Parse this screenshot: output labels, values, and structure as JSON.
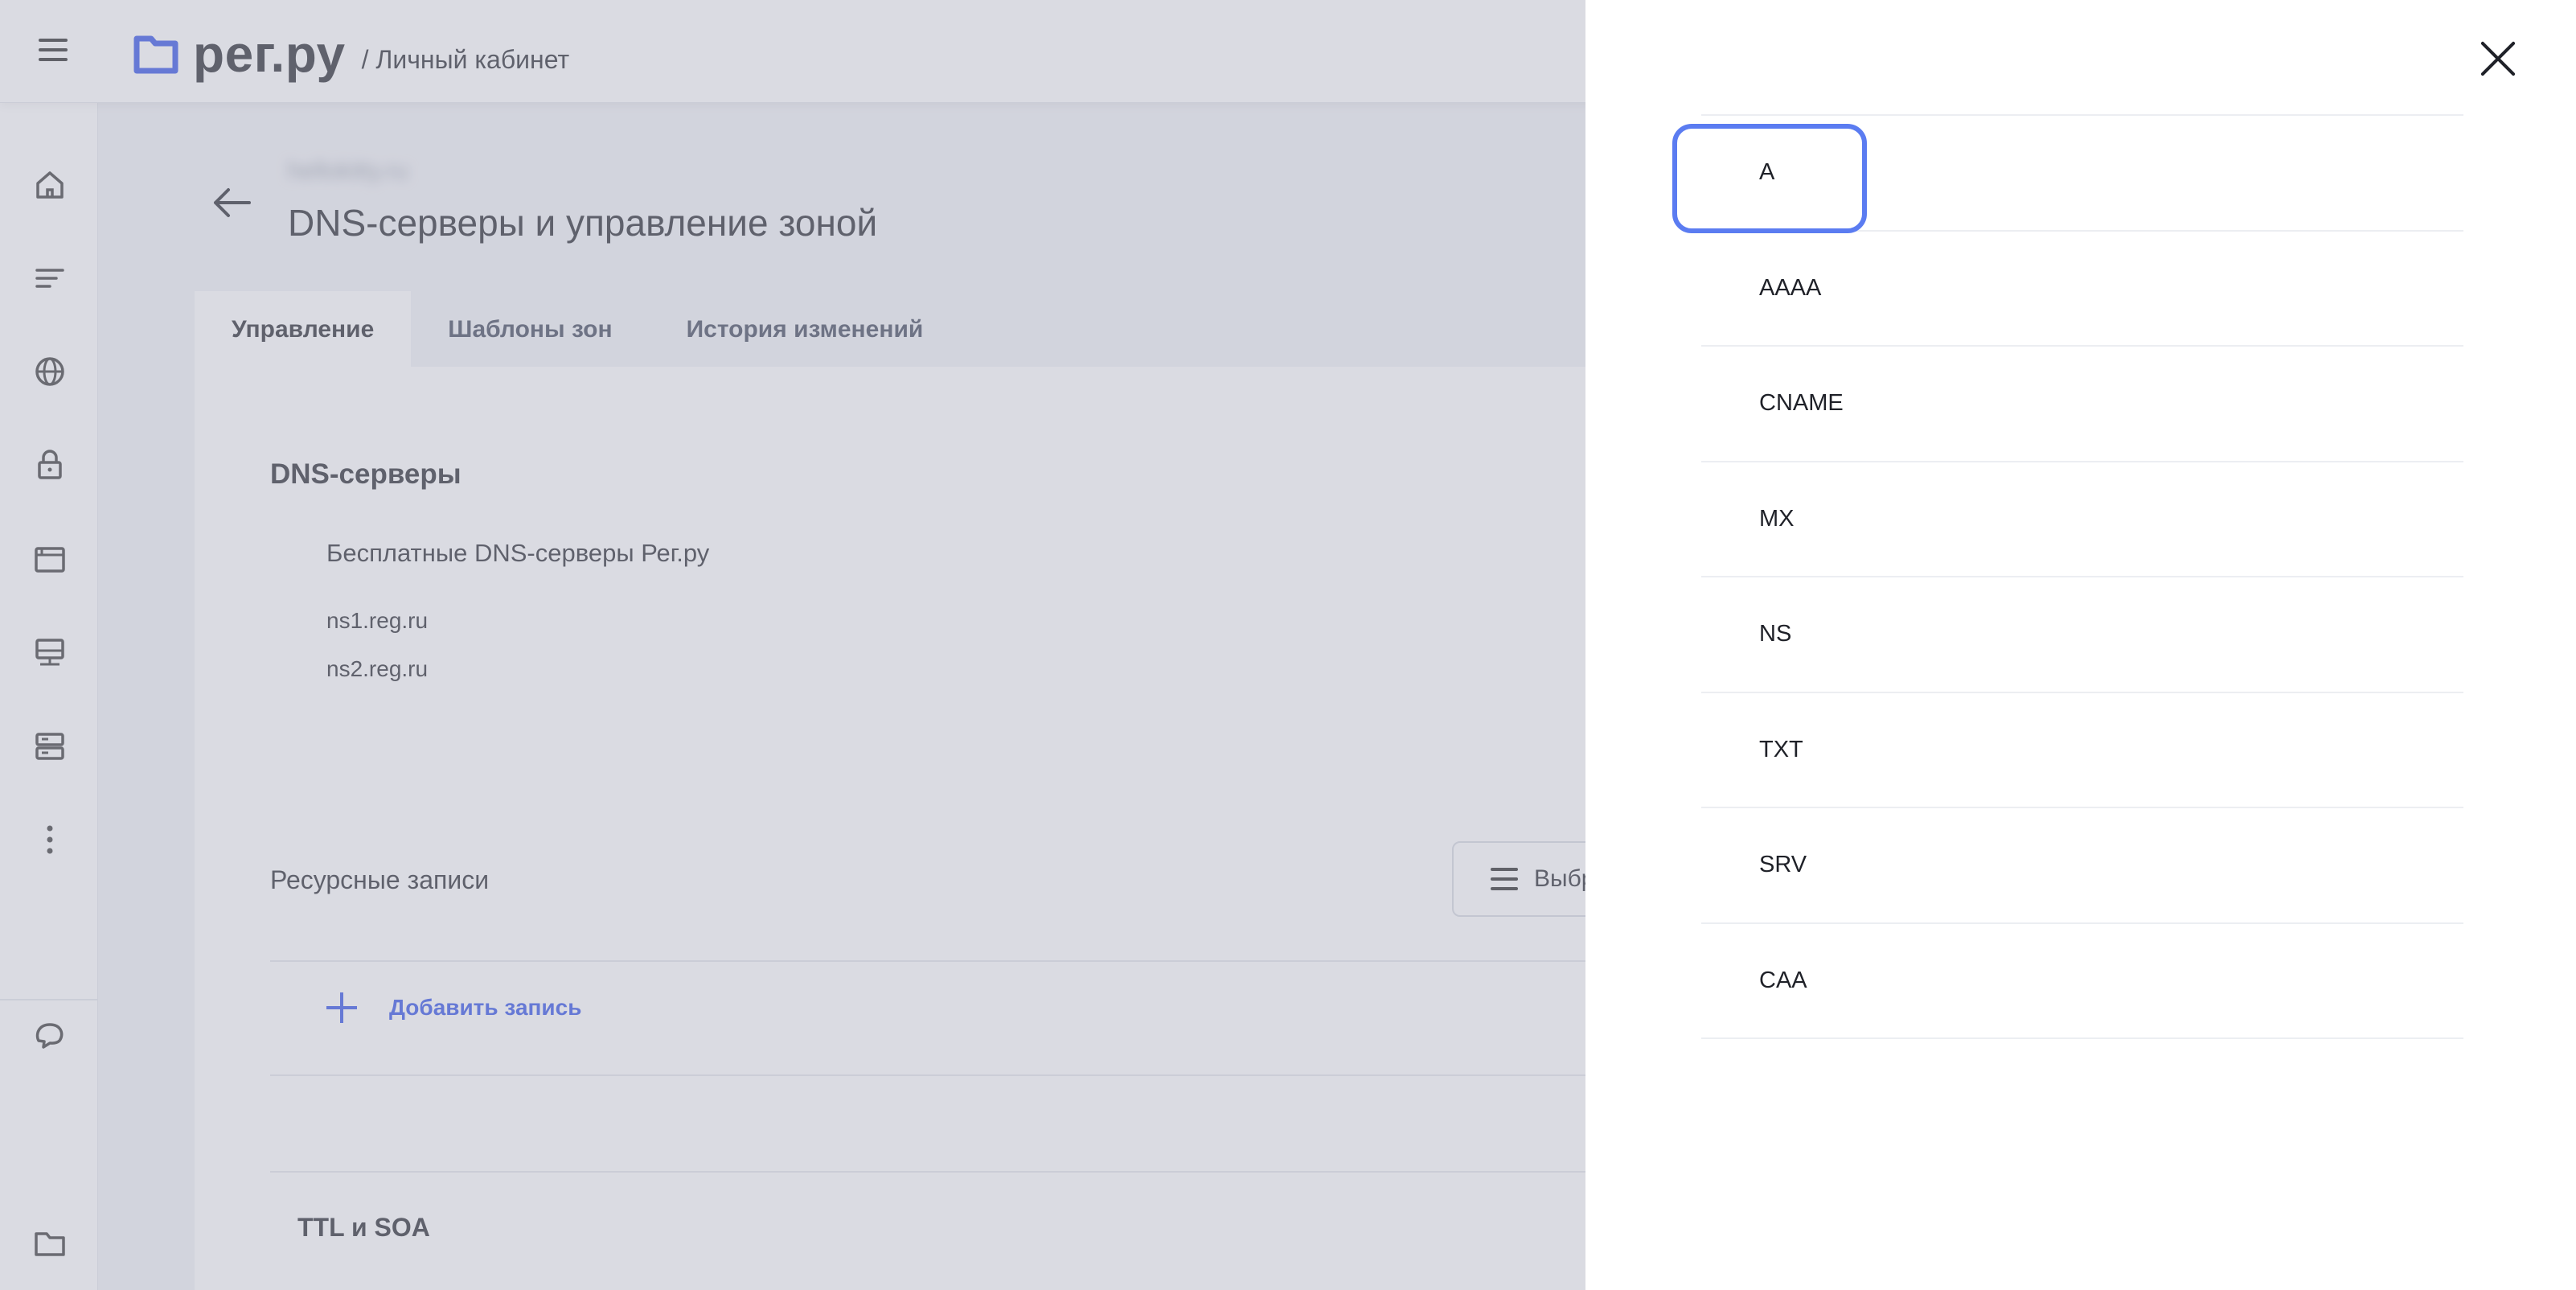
{
  "header": {
    "logo_text": "рег.ру",
    "subtitle": "/ Личный кабинет"
  },
  "sidebar": {
    "icons": [
      "home-icon",
      "list-icon",
      "globe-icon",
      "lock-icon",
      "browser-window-icon",
      "monitor-icon",
      "server-icon",
      "more-dots-icon",
      "chat-icon",
      "folder-icon"
    ]
  },
  "page": {
    "domain": "hellokitty.ru",
    "title": "DNS-серверы и управление зоной",
    "tabs": [
      {
        "label": "Управление",
        "active": true
      },
      {
        "label": "Шаблоны зон",
        "active": false
      },
      {
        "label": "История изменений",
        "active": false
      }
    ],
    "dns_section_title": "DNS-серверы",
    "free_dns_label": "Бесплатные DNS-серверы Рег.ру",
    "nameservers": [
      "ns1.reg.ru",
      "ns2.reg.ru"
    ],
    "resource_records_title": "Ресурсные записи",
    "select_button_label": "Выбр",
    "add_record_label": "Добавить запись",
    "ttl_soa_title": "TTL и SOA"
  },
  "drawer": {
    "record_types": [
      "A",
      "AAAA",
      "CNAME",
      "MX",
      "NS",
      "TXT",
      "SRV",
      "CAA"
    ],
    "focused_index": 0,
    "accent_color": "#5b7cf1"
  }
}
